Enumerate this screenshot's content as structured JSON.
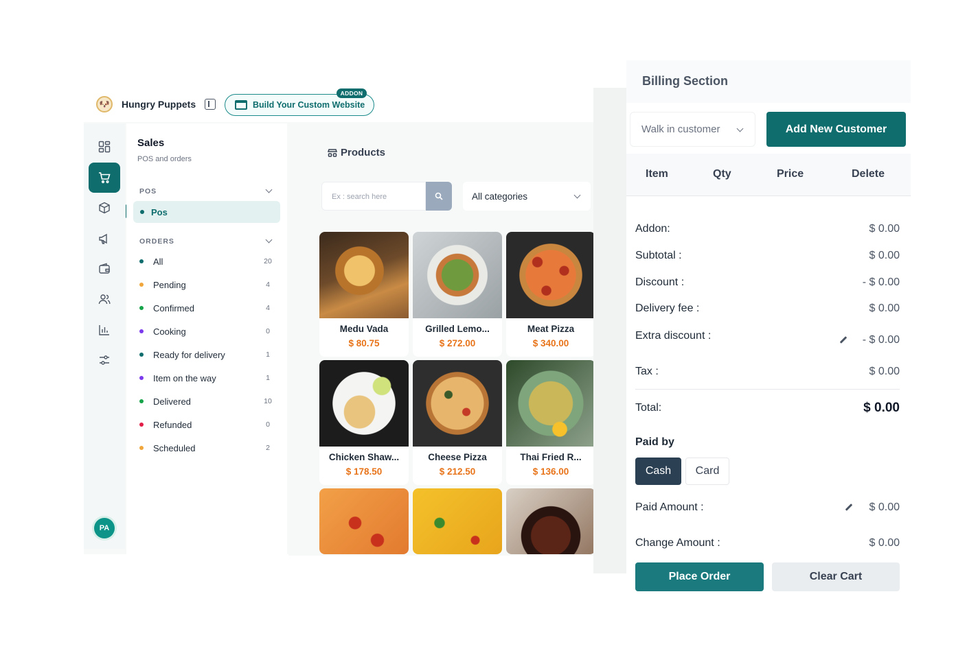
{
  "header": {
    "brand_name": "Hungry Puppets",
    "build_label": "Build Your Custom Website",
    "addon_badge": "ADDON"
  },
  "rail": {
    "avatar_initials": "PA",
    "icons": [
      "dashboard-icon",
      "cart-icon",
      "box-icon",
      "megaphone-icon",
      "wallet-icon",
      "users-icon",
      "bar-chart-icon",
      "settings-sliders-icon"
    ]
  },
  "sidebar": {
    "title": "Sales",
    "subtitle": "POS and orders",
    "pos_section": "POS",
    "pos_item": "Pos",
    "orders_section": "ORDERS",
    "orders": [
      {
        "label": "All",
        "count": "20",
        "color": "#0f6d6d"
      },
      {
        "label": "Pending",
        "count": "4",
        "color": "#f0a63a"
      },
      {
        "label": "Confirmed",
        "count": "4",
        "color": "#16a34a"
      },
      {
        "label": "Cooking",
        "count": "0",
        "color": "#7c3aed"
      },
      {
        "label": "Ready for delivery",
        "count": "1",
        "color": "#0f6d6d"
      },
      {
        "label": "Item on the way",
        "count": "1",
        "color": "#7c3aed"
      },
      {
        "label": "Delivered",
        "count": "10",
        "color": "#16a34a"
      },
      {
        "label": "Refunded",
        "count": "0",
        "color": "#e11d48"
      },
      {
        "label": "Scheduled",
        "count": "2",
        "color": "#f0a63a"
      }
    ]
  },
  "products": {
    "title": "Products",
    "search_placeholder": "Ex : search here",
    "category": "All categories",
    "items": [
      {
        "name": "Medu Vada",
        "price": "$ 80.75"
      },
      {
        "name": "Grilled Lemo...",
        "price": "$ 272.00"
      },
      {
        "name": "Meat Pizza",
        "price": "$ 340.00"
      },
      {
        "name": "Chicken Shaw...",
        "price": "$ 178.50"
      },
      {
        "name": "Cheese Pizza",
        "price": "$ 212.50"
      },
      {
        "name": "Thai Fried R...",
        "price": "$ 136.00"
      }
    ]
  },
  "billing": {
    "title": "Billing Section",
    "customer": "Walk in customer",
    "add_customer": "Add New Customer",
    "columns": {
      "item": "Item",
      "qty": "Qty",
      "price": "Price",
      "delete": "Delete"
    },
    "addon_label": "Addon:",
    "addon_value": "$ 0.00",
    "subtotal_label": "Subtotal :",
    "subtotal_value": "$ 0.00",
    "discount_label": "Discount :",
    "discount_value": "- $ 0.00",
    "delivery_label": "Delivery fee :",
    "delivery_value": "$ 0.00",
    "extra_label": "Extra discount :",
    "extra_value": "- $ 0.00",
    "tax_label": "Tax :",
    "tax_value": "$ 0.00",
    "total_label": "Total:",
    "total_value": "$ 0.00",
    "paid_by": "Paid by",
    "cash": "Cash",
    "card": "Card",
    "paid_amount_label": "Paid Amount :",
    "paid_amount_value": "$ 0.00",
    "change_label": "Change Amount :",
    "change_value": "$ 0.00",
    "place_order": "Place Order",
    "clear_cart": "Clear Cart"
  }
}
